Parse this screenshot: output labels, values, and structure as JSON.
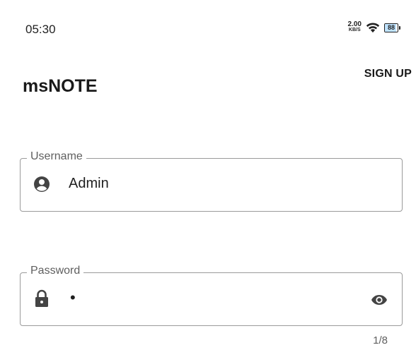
{
  "status_bar": {
    "time": "05:30",
    "net_speed_value": "2.00",
    "net_speed_unit": "KB/S",
    "wifi_icon": "wifi-icon",
    "battery_level": "88",
    "battery_fraction": 0.88
  },
  "header": {
    "app_title": "msNOTE",
    "signup_label": "SIGN UP"
  },
  "form": {
    "username": {
      "label": "Username",
      "value": "Admin",
      "icon": "account-circle-icon"
    },
    "password": {
      "label": "Password",
      "value": "•",
      "icon": "lock-icon",
      "toggle_icon": "eye-icon",
      "counter": "1/8"
    }
  }
}
